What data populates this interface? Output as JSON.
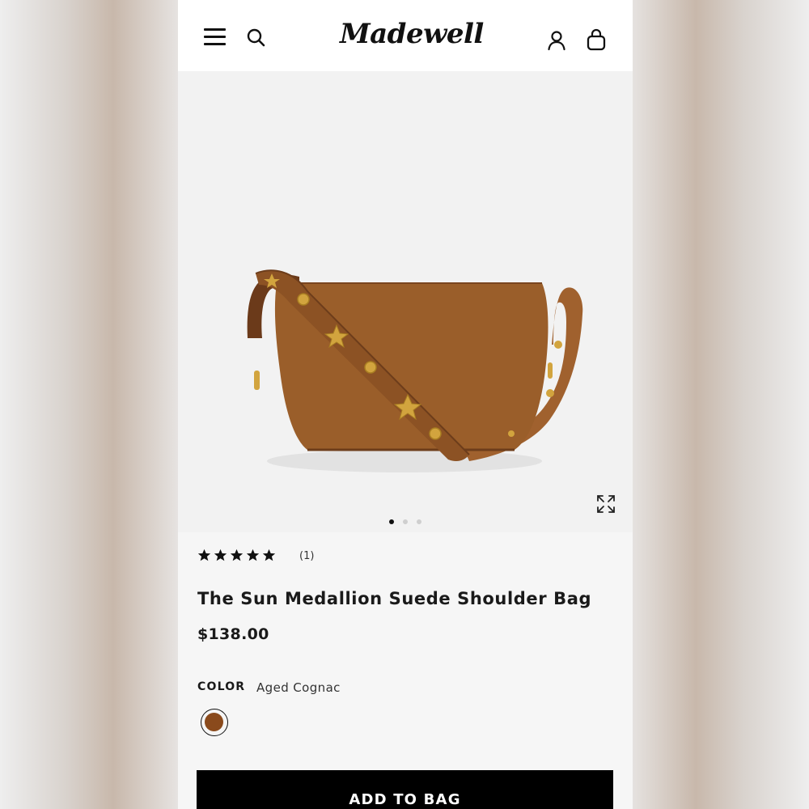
{
  "header": {
    "logo_text": "Madewell",
    "menu_icon": "hamburger-menu-icon",
    "search_icon": "search-icon",
    "account_icon": "user-account-icon",
    "bag_icon": "shopping-bag-icon"
  },
  "gallery": {
    "image_alt": "The Sun Medallion Suede Shoulder Bag",
    "expand_icon": "expand-icon",
    "slide_count": 3,
    "active_slide": 1
  },
  "product": {
    "rating_stars": 5,
    "rating_count": "(1)",
    "title": "The Sun Medallion Suede Shoulder Bag",
    "price": "$138.00",
    "color_label": "COLOR",
    "color_value": "Aged Cognac",
    "swatch_color": "#8a4a1c"
  },
  "cta": {
    "add_to_bag_label": "ADD TO BAG"
  },
  "colors": {
    "suede": "#9a5e2a",
    "leather": "#a0612e",
    "gold": "#d2a43e",
    "black": "#000000"
  }
}
